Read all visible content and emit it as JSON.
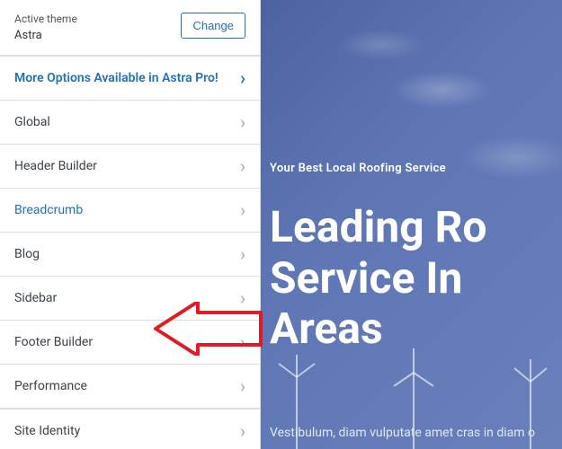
{
  "theme": {
    "label": "Active theme",
    "name": "Astra",
    "change_label": "Change"
  },
  "promo": {
    "label": "More Options Available in Astra Pro!"
  },
  "menu": {
    "global": "Global",
    "header_builder": "Header Builder",
    "breadcrumb": "Breadcrumb",
    "blog": "Blog",
    "sidebar": "Sidebar",
    "footer_builder": "Footer Builder",
    "performance": "Performance",
    "site_identity": "Site Identity"
  },
  "preview": {
    "tagline": "Your Best Local Roofing Service",
    "headline": "Leading Ro\nService In \nAreas",
    "subtext": "Vestibulum, diam vulputate amet cras in diam o"
  },
  "annotation": {
    "arrow_color": "#e01b24",
    "target": "footer_builder"
  }
}
